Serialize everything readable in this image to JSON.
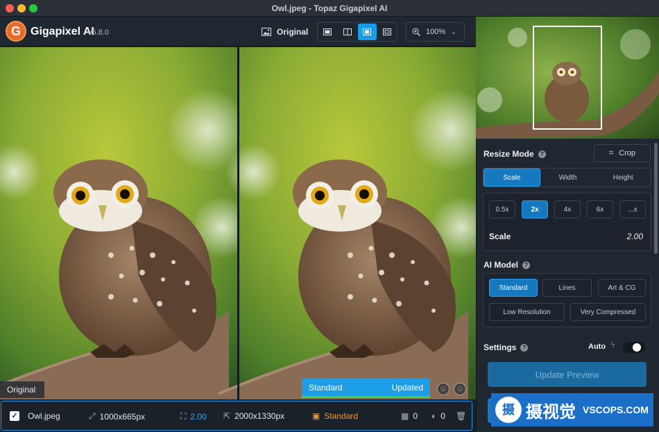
{
  "window": {
    "title": "Owl.jpeg - Topaz Gigapixel AI"
  },
  "header": {
    "logo_letter": "G",
    "app_name": "Gigapixel AI",
    "version": "v5.8.0",
    "original_label": "Original",
    "zoom": "100%"
  },
  "canvas": {
    "left_label": "Original",
    "status_model": "Standard",
    "status_state": "Updated",
    "progress_fraction": 1.0
  },
  "panel": {
    "resize_mode_label": "Resize Mode",
    "crop_label": "Crop",
    "resize_tabs": [
      {
        "label": "Scale",
        "active": true
      },
      {
        "label": "Width",
        "active": false
      },
      {
        "label": "Height",
        "active": false
      }
    ],
    "scale_options": [
      {
        "label": "0.5x",
        "active": false
      },
      {
        "label": "2x",
        "active": true
      },
      {
        "label": "4x",
        "active": false
      },
      {
        "label": "6x",
        "active": false
      },
      {
        "label": "...x",
        "active": false
      }
    ],
    "scale_label": "Scale",
    "scale_value": "2.00",
    "ai_model_label": "AI Model",
    "models": [
      {
        "label": "Standard",
        "active": true
      },
      {
        "label": "Lines",
        "active": false
      },
      {
        "label": "Art & CG",
        "active": false
      },
      {
        "label": "Low Resolution",
        "active": false
      },
      {
        "label": "Very Compressed",
        "active": false
      }
    ],
    "settings_label": "Settings",
    "auto_label": "Auto",
    "auto_on": true,
    "update_preview_label": "Update Preview"
  },
  "file_row": {
    "checked": true,
    "name": "Owl.jpeg",
    "input_size": "1000x665px",
    "scale": "2.00",
    "output_size": "2000x1330px",
    "model": "Standard",
    "noise_value": "0",
    "blur_value": "0"
  },
  "watermark": {
    "logo_char": "摄",
    "cn_text": "摄视觉",
    "en_text": "VSCOPS.COM"
  },
  "colors": {
    "accent": "#1a9ee8",
    "model_orange": "#f2983b",
    "progress_green": "#35d24a"
  }
}
